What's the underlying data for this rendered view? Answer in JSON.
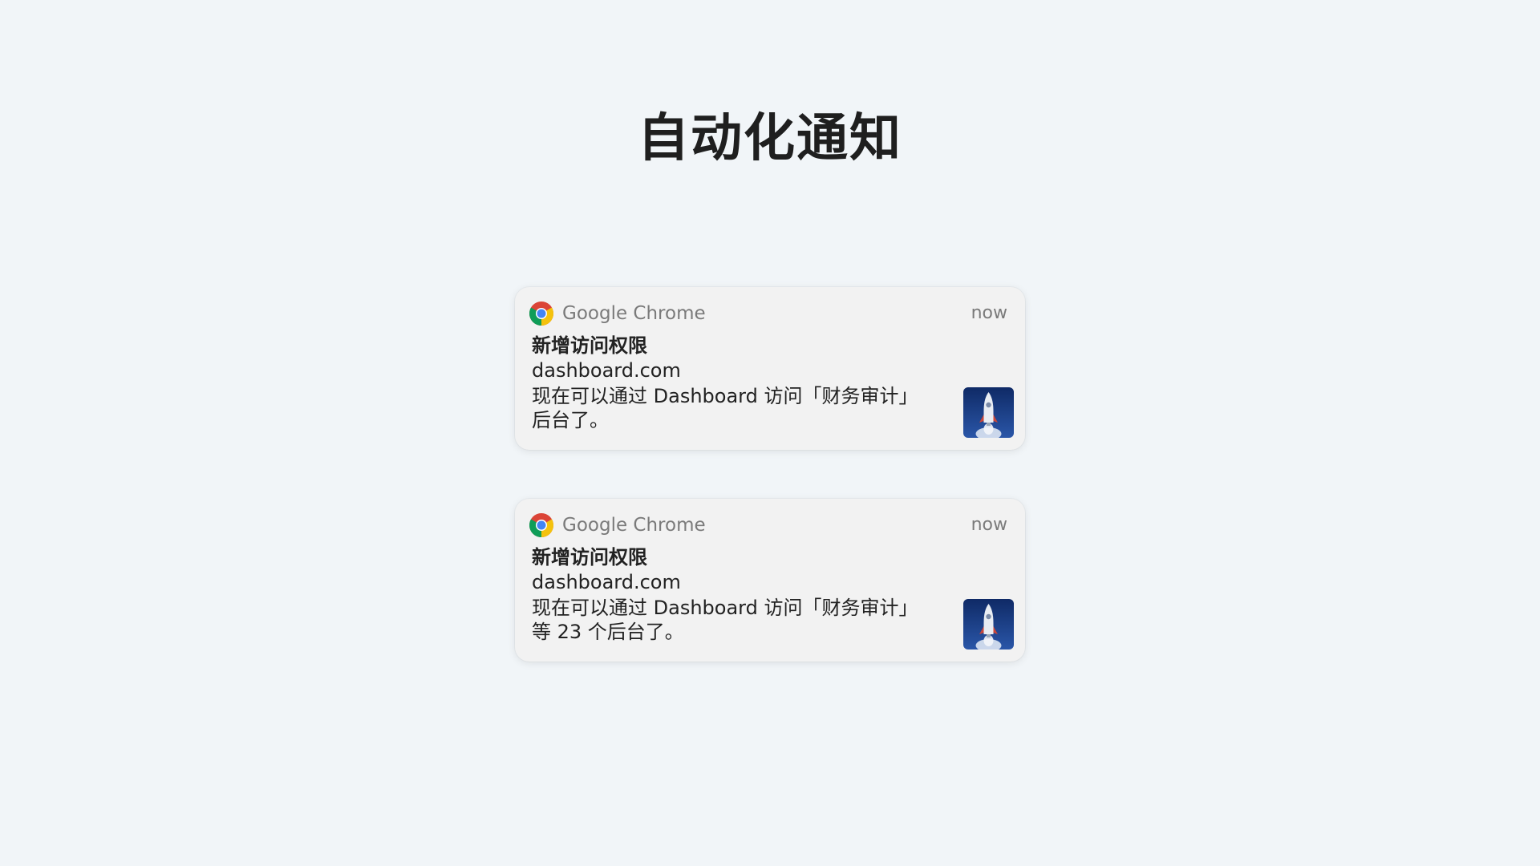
{
  "page": {
    "title": "自动化通知"
  },
  "notifications": [
    {
      "app_name": "Google Chrome",
      "app_icon": "chrome-icon",
      "time": "now",
      "title": "新增访问权限",
      "site": "dashboard.com",
      "message": "现在可以通过 Dashboard 访问「财务审计」后台了。",
      "thumbnail": "rocket-image"
    },
    {
      "app_name": "Google Chrome",
      "app_icon": "chrome-icon",
      "time": "now",
      "title": "新增访问权限",
      "site": "dashboard.com",
      "message": "现在可以通过 Dashboard 访问「财务审计」等 23 个后台了。",
      "thumbnail": "rocket-image"
    }
  ],
  "colors": {
    "background": "#f1f5f8",
    "card": "#f2f2f2",
    "text_primary": "#222222",
    "text_secondary": "#7a7a7a",
    "chrome_red": "#db4437",
    "chrome_yellow": "#f4c20d",
    "chrome_green": "#0f9d58",
    "chrome_blue": "#4285f4",
    "thumbnail_bg": "#1d3f86"
  }
}
